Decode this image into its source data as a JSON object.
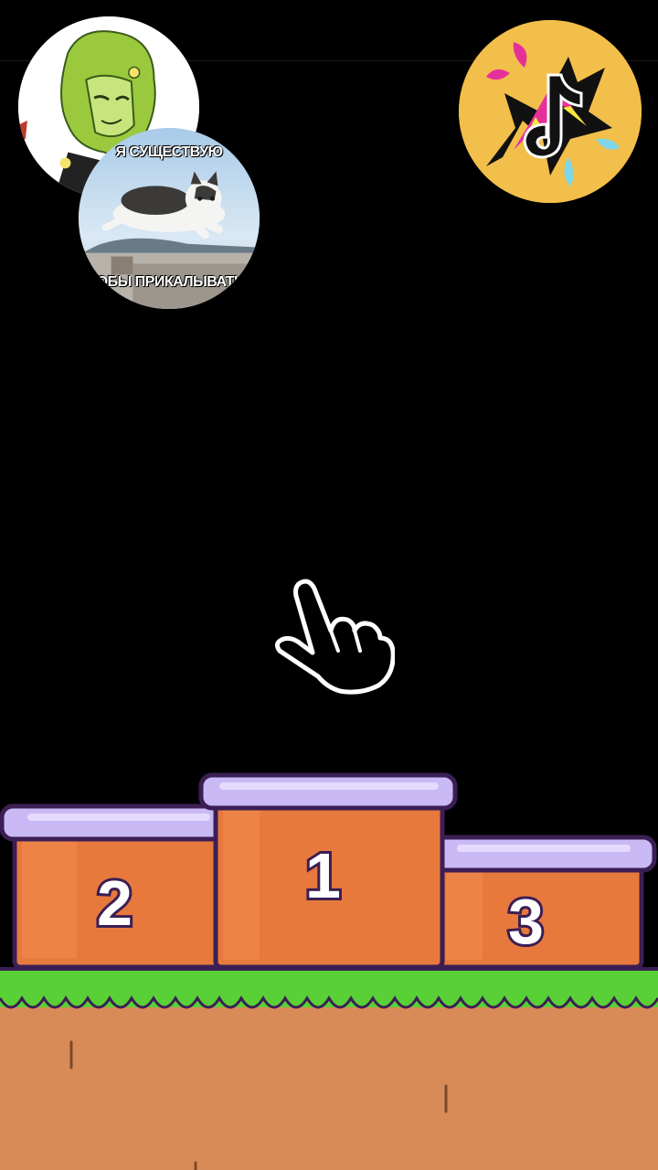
{
  "avatars": {
    "oc": {
      "icon": "green-haired-character-avatar-icon"
    },
    "cat_meme": {
      "caption_top": "Я СУЩЕСТВУЮ",
      "caption_bottom": "ЧТОБЫ ПРИКАЛЫВАТЬСЯ",
      "icon": "leaping-cat-photo-icon"
    },
    "tiktok": {
      "icon": "tiktok-logo-icon",
      "color": "#f2bf4b"
    }
  },
  "hand": {
    "icon": "pointing-hand-icon"
  },
  "podium": {
    "first": "1",
    "second": "2",
    "third": "3",
    "colors": {
      "block": "#e8793d",
      "top": "#c9b9f5",
      "outline": "#3b1f54"
    }
  },
  "ground": {
    "grass": "#59d136",
    "dirt": "#d98b57"
  }
}
